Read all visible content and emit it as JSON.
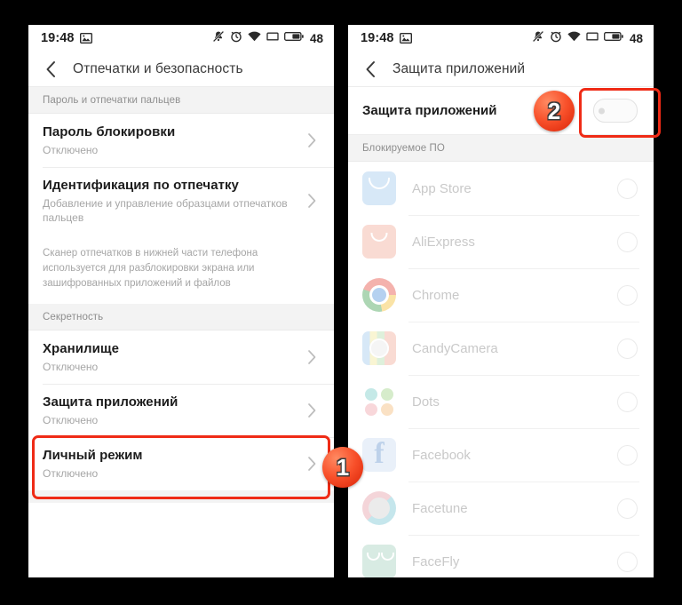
{
  "status_bar": {
    "time": "19:48",
    "battery_percent": "48",
    "icons": [
      "photo-icon",
      "vibrate-off-icon",
      "alarm-clock-icon",
      "wifi-icon",
      "sim-card-icon",
      "battery-icon"
    ]
  },
  "left_screen": {
    "title": "Отпечатки и безопасность",
    "back_icon": "back-chevron-icon",
    "sections": [
      {
        "header": "Пароль и отпечатки пальцев",
        "rows": [
          {
            "title": "Пароль блокировки",
            "subtitle": "Отключено",
            "chevron": "chevron-right-icon"
          },
          {
            "title": "Идентификация по отпечатку",
            "subtitle": "Добавление и управление образцами отпечатков пальцев",
            "chevron": "chevron-right-icon"
          }
        ],
        "note": "Сканер отпечатков в нижней части телефона используется для разблокировки экрана или зашифрованных приложений и файлов"
      },
      {
        "header": "Секретность",
        "rows": [
          {
            "title": "Хранилище",
            "subtitle": "Отключено",
            "chevron": "chevron-right-icon"
          },
          {
            "title": "Защита приложений",
            "subtitle": "Отключено",
            "chevron": "chevron-right-icon"
          },
          {
            "title": "Личный режим",
            "subtitle": "Отключено",
            "chevron": "chevron-right-icon"
          }
        ]
      }
    ]
  },
  "right_screen": {
    "title": "Защита приложений",
    "back_icon": "back-chevron-icon",
    "toggle": {
      "label": "Защита приложений",
      "state": "off"
    },
    "section_header": "Блокируемое ПО",
    "apps": [
      {
        "name": "App Store",
        "icon": "app-store-icon",
        "selected": false
      },
      {
        "name": "AliExpress",
        "icon": "aliexpress-icon",
        "selected": false
      },
      {
        "name": "Chrome",
        "icon": "chrome-icon",
        "selected": false
      },
      {
        "name": "CandyCamera",
        "icon": "candycamera-icon",
        "selected": false
      },
      {
        "name": "Dots",
        "icon": "dots-icon",
        "selected": false
      },
      {
        "name": "Facebook",
        "icon": "facebook-icon",
        "selected": false
      },
      {
        "name": "Facetune",
        "icon": "facetune-icon",
        "selected": false
      },
      {
        "name": "FaceFly",
        "icon": "facefly-icon",
        "selected": false
      }
    ]
  },
  "annotations": {
    "step_one": "1",
    "step_two": "2",
    "highlight_color": "#ef2b16"
  }
}
